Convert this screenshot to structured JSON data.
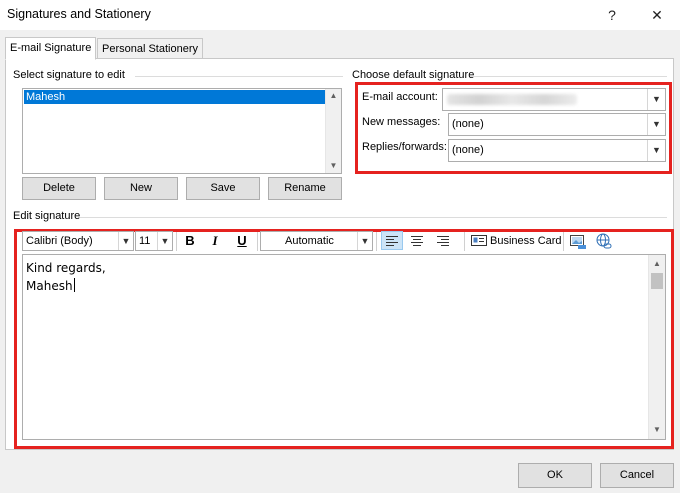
{
  "window": {
    "title": "Signatures and Stationery",
    "help": "?",
    "close": "✕"
  },
  "tabs": [
    {
      "label": "E-mail Signature",
      "active": true
    },
    {
      "label": "Personal Stationery",
      "active": false
    }
  ],
  "select_signature": {
    "label": "Select signature to edit",
    "items": [
      "Mahesh"
    ],
    "selected": "Mahesh",
    "buttons": {
      "delete": "Delete",
      "new": "New",
      "save": "Save",
      "rename": "Rename"
    }
  },
  "default_signature": {
    "label": "Choose default signature",
    "email_account_label": "E-mail account:",
    "email_account_value": "",
    "new_messages_label": "New messages:",
    "new_messages_value": "(none)",
    "replies_label": "Replies/forwards:",
    "replies_value": "(none)"
  },
  "edit_signature": {
    "label": "Edit signature",
    "font": "Calibri (Body)",
    "size": "11",
    "bold": "B",
    "italic": "I",
    "underline": "U",
    "color": "Automatic",
    "business_card": "Business Card",
    "lines": [
      "Kind regards,",
      "Mahesh"
    ]
  },
  "footer": {
    "ok": "OK",
    "cancel": "Cancel"
  },
  "colors": {
    "highlight": "#e5221f",
    "selection": "#0078d7"
  }
}
